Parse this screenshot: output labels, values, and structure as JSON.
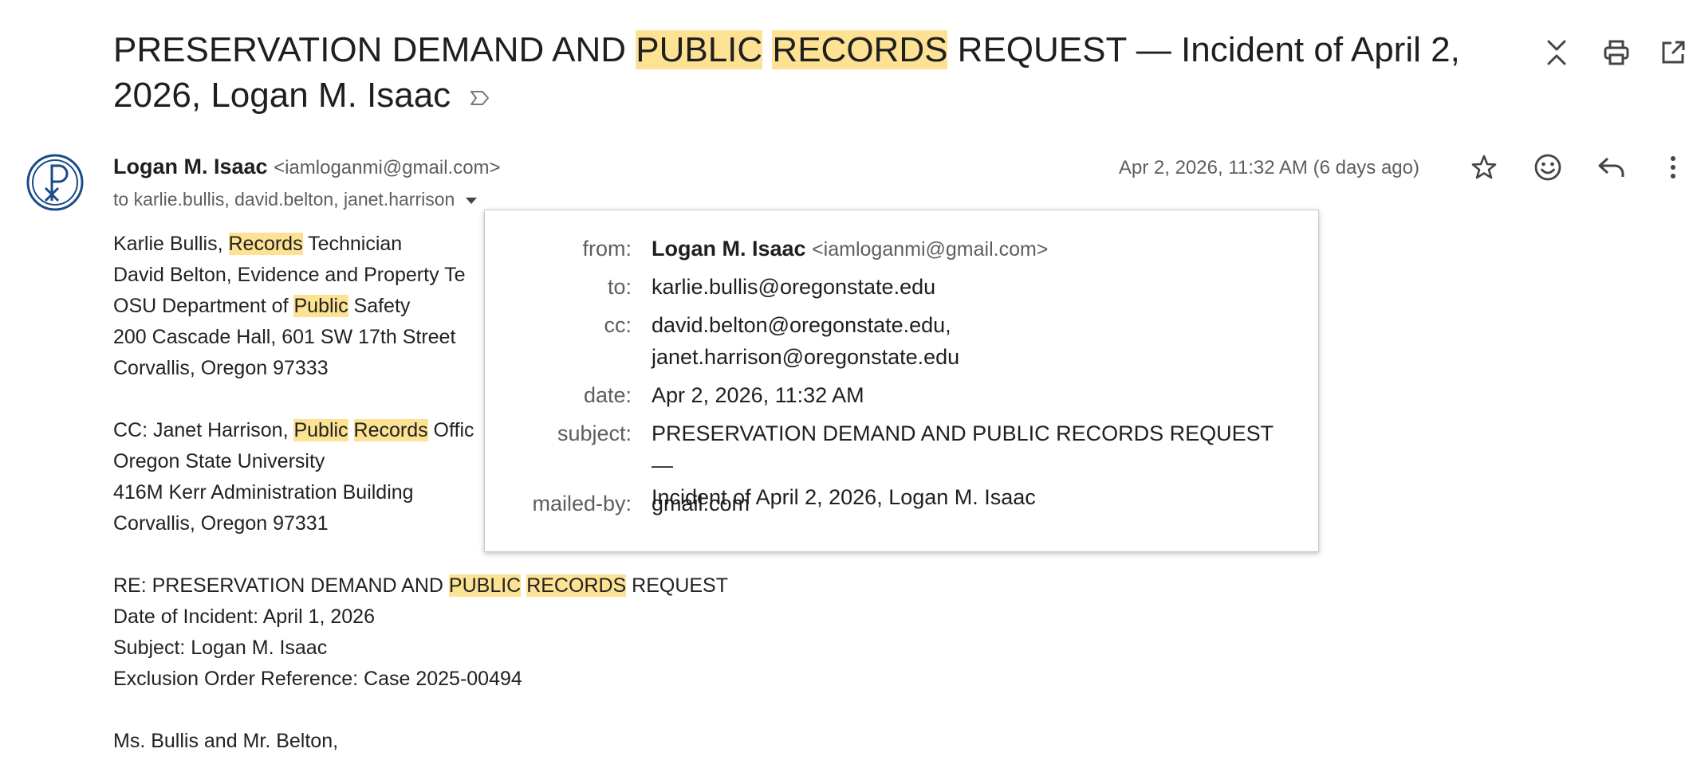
{
  "subject": {
    "parts": [
      "PRESERVATION DEMAND AND ",
      "PUBLIC",
      " ",
      "RECORDS",
      " REQUEST — Incident of April 2, 2026, Logan M. Isaac"
    ]
  },
  "toolbar": {
    "icons": [
      "collapse-all-icon",
      "print-icon",
      "open-in-new-window-icon"
    ]
  },
  "message": {
    "sender_name": "Logan M. Isaac",
    "sender_email": "<iamloganmi@gmail.com>",
    "to_summary": "to karlie.bullis, david.belton, janet.harrison",
    "date": "Apr 2, 2026, 11:32 AM (6 days ago)",
    "actions": [
      "star-icon",
      "emoji-icon",
      "reply-icon",
      "more-vert-icon"
    ]
  },
  "body": {
    "lines": [
      [
        "Karlie Bullis, ",
        "Records",
        " Technician"
      ],
      [
        "David Belton, Evidence and Property Te"
      ],
      [
        "OSU Department of ",
        "Public",
        " Safety"
      ],
      [
        "200 Cascade Hall, 601 SW 17th Street"
      ],
      [
        "Corvallis, Oregon 97333"
      ],
      [],
      [
        "CC: Janet Harrison, ",
        "Public",
        " ",
        "Records",
        " Offic"
      ],
      [
        "Oregon State University"
      ],
      [
        "416M Kerr Administration Building"
      ],
      [
        "Corvallis, Oregon 97331"
      ],
      [],
      [
        "RE: PRESERVATION DEMAND AND ",
        "PUBLIC",
        " ",
        "RECORDS",
        " REQUEST"
      ],
      [
        "Date of Incident: April 1, 2026"
      ],
      [
        "Subject: Logan M. Isaac"
      ],
      [
        "Exclusion Order Reference: Case 2025-00494"
      ],
      [],
      [
        "Ms. Bullis and Mr. Belton,"
      ]
    ]
  },
  "details": {
    "from_label": "from:",
    "from_name": "Logan M. Isaac",
    "from_email": "<iamloganmi@gmail.com>",
    "to_label": "to:",
    "to_value": "karlie.bullis@oregonstate.edu",
    "cc_label": "cc:",
    "cc_line1": "david.belton@oregonstate.edu,",
    "cc_line2": "janet.harrison@oregonstate.edu",
    "date_label": "date:",
    "date_value": "Apr 2, 2026, 11:32 AM",
    "subject_label": "subject:",
    "subject_line1": "PRESERVATION DEMAND AND PUBLIC RECORDS REQUEST —",
    "subject_line2": "Incident of April 2, 2026, Logan M. Isaac",
    "mailed_by_label": "mailed-by:",
    "mailed_by_value": "gmail.com"
  },
  "colors": {
    "highlight": "#fde293",
    "text": "#1f1f1f",
    "muted": "#5e5e5e",
    "avatar": "#1b4a8a"
  }
}
